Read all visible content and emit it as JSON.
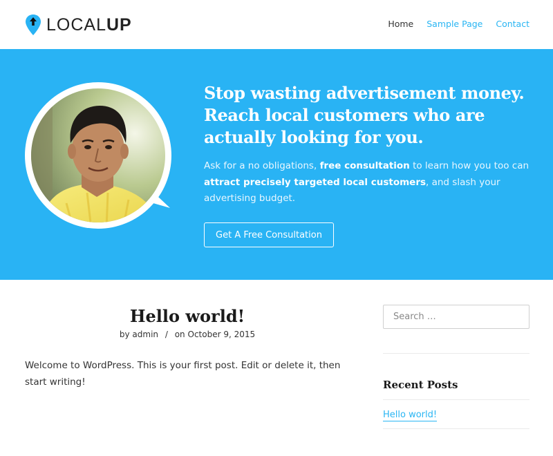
{
  "header": {
    "logo_text_light": "LOCAL",
    "logo_text_bold": "UP",
    "nav": [
      {
        "label": "Home",
        "active": true
      },
      {
        "label": "Sample Page",
        "active": false
      },
      {
        "label": "Contact",
        "active": false
      }
    ]
  },
  "hero": {
    "title": "Stop wasting advertisement money. Reach local customers who are actually looking for you.",
    "desc_part1": "Ask for a no obligations, ",
    "desc_bold1": "free consultation",
    "desc_part2": " to learn how you too can ",
    "desc_bold2": "attract precisely targeted local customers",
    "desc_part3": ", and slash your advertising budget.",
    "cta_label": "Get A Free Consultation"
  },
  "post": {
    "title": "Hello world!",
    "by_prefix": "by",
    "author": "admin",
    "separator": "/",
    "date_prefix": "on",
    "date": "October 9, 2015",
    "body": "Welcome to WordPress. This is your first post. Edit or delete it, then start writing!"
  },
  "sidebar": {
    "search_placeholder": "Search …",
    "recent_title": "Recent Posts",
    "recent_posts": [
      "Hello world!"
    ]
  },
  "colors": {
    "accent": "#29b3f4",
    "text": "#333333",
    "white": "#ffffff"
  },
  "icons": {
    "logo": "map-pin-arrow-icon"
  }
}
